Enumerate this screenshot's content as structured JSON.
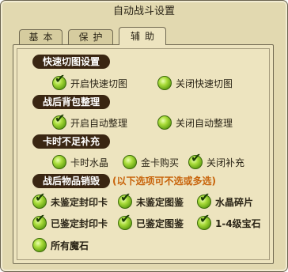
{
  "window": {
    "title": "自动战斗设置"
  },
  "tabs": [
    {
      "label": "基本",
      "active": false
    },
    {
      "label": "保护",
      "active": false
    },
    {
      "label": "辅助",
      "active": true
    }
  ],
  "sections": {
    "fast_switch": {
      "header": "快速切图设置",
      "options": [
        {
          "label": "开启快速切图",
          "checked": true
        },
        {
          "label": "关闭快速切图",
          "checked": false
        }
      ]
    },
    "bag_cleanup": {
      "header": "战后背包整理",
      "options": [
        {
          "label": "开启自动整理",
          "checked": true
        },
        {
          "label": "关闭自动整理",
          "checked": false
        }
      ]
    },
    "card_refill": {
      "header": "卡时不足补充",
      "options": [
        {
          "label": "卡时水晶",
          "checked": false
        },
        {
          "label": "金卡购买",
          "checked": false
        },
        {
          "label": "关闭补充",
          "checked": true
        }
      ]
    },
    "item_destroy": {
      "header": "战后物品销毁",
      "note": "(以下选项可不选或多选)",
      "options": [
        {
          "label": "未鉴定封印卡",
          "checked": true
        },
        {
          "label": "未鉴定图鉴",
          "checked": true
        },
        {
          "label": "水晶碎片",
          "checked": true
        },
        {
          "label": "已鉴定封印卡",
          "checked": true
        },
        {
          "label": "已鉴定图鉴",
          "checked": true
        },
        {
          "label": "1-4级宝石",
          "checked": true
        },
        {
          "label": "所有魔石",
          "checked": false
        }
      ]
    }
  },
  "colors": {
    "header_bg": "#3a2612",
    "note": "#c8630a",
    "radio_green": "#a9dc3a",
    "panel_bg": "#ede4bf"
  }
}
